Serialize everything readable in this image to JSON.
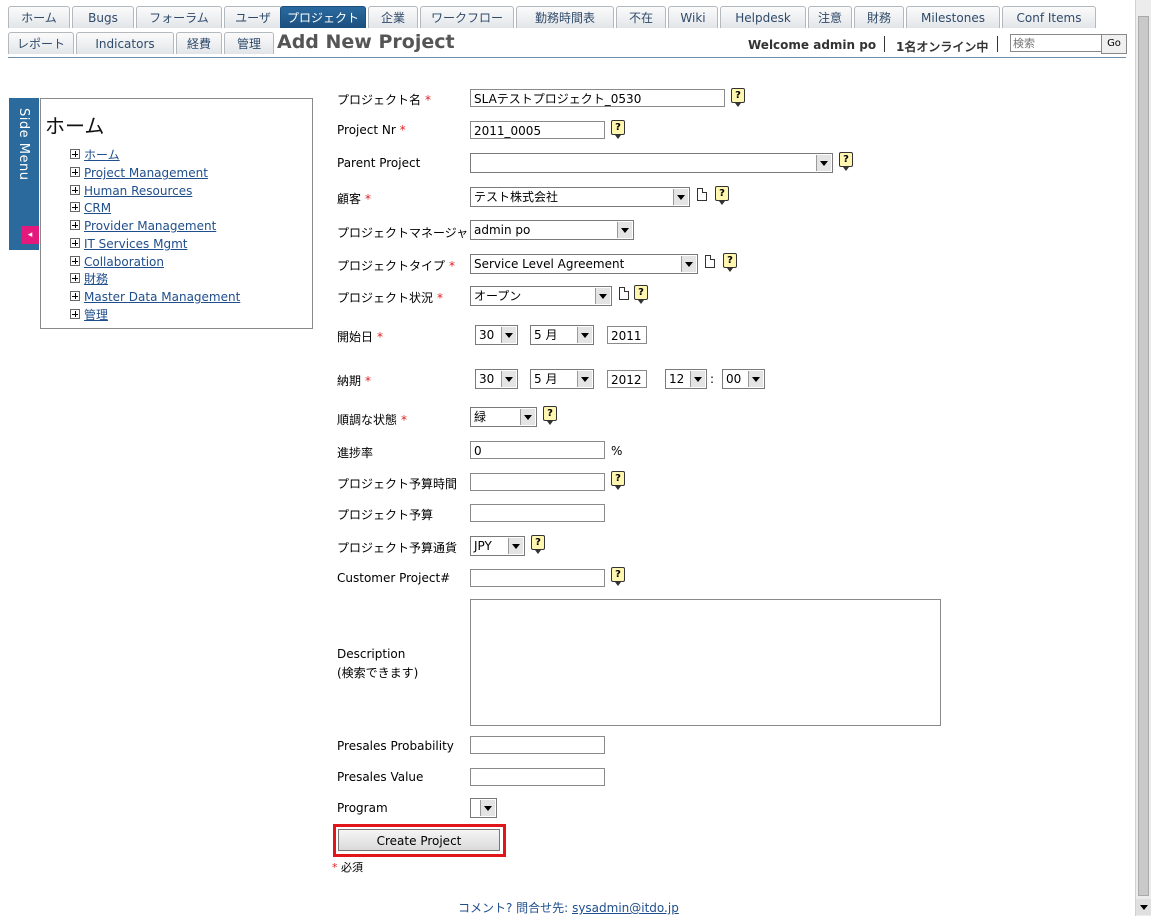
{
  "tabs_row1": [
    "ホーム",
    "Bugs",
    "フォーラム",
    "ユーザ",
    "プロジェクト",
    "企業",
    "ワークフロー",
    "勤務時間表",
    "不在",
    "Wiki",
    "Helpdesk",
    "注意",
    "財務",
    "Milestones",
    "Conf Items"
  ],
  "tabs_row2": [
    "レポート",
    "Indicators",
    "経費",
    "管理"
  ],
  "active_tab": "プロジェクト",
  "header": {
    "page_title": "Add New Project",
    "welcome": "Welcome admin po",
    "online": "1名オンライン中",
    "search_placeholder": "検索",
    "go_label": "Go"
  },
  "sidemenu": {
    "vertical_label": "Side Menu",
    "title": "ホーム",
    "items": [
      "ホーム",
      "Project Management",
      "Human Resources",
      "CRM",
      "Provider Management",
      "IT Services Mgmt",
      "Collaboration",
      "財務",
      "Master Data Management",
      "管理"
    ]
  },
  "form": {
    "project_name": {
      "label": "プロジェクト名",
      "value": "SLAテストプロジェクト_0530"
    },
    "project_nr": {
      "label": "Project Nr",
      "value": "2011_0005"
    },
    "parent_project": {
      "label": "Parent Project",
      "value": ""
    },
    "customer": {
      "label": "顧客",
      "value": "テスト株式会社"
    },
    "project_manager": {
      "label": "プロジェクトマネージャ",
      "value": "admin po"
    },
    "project_type": {
      "label": "プロジェクトタイプ",
      "value": "Service Level Agreement"
    },
    "project_status": {
      "label": "プロジェクト状況",
      "value": "オープン"
    },
    "start_date": {
      "label": "開始日",
      "day": "30",
      "month": "5 月",
      "year": "2011"
    },
    "end_date": {
      "label": "納期",
      "day": "30",
      "month": "5 月",
      "year": "2012",
      "hour": "12",
      "minute": "00",
      "sep": ":"
    },
    "on_track": {
      "label": "順調な状態",
      "value": "緑"
    },
    "percent_completed": {
      "label": "進捗率",
      "value": "0",
      "unit": "%"
    },
    "budget_hours": {
      "label": "プロジェクト予算時間",
      "value": ""
    },
    "budget": {
      "label": "プロジェクト予算",
      "value": ""
    },
    "budget_currency": {
      "label": "プロジェクト予算通貨",
      "value": "JPY"
    },
    "customer_project_nr": {
      "label": "Customer Project#",
      "value": ""
    },
    "description": {
      "label": "Description",
      "sublabel": "(検索できます)",
      "value": ""
    },
    "presales_probability": {
      "label": "Presales Probability",
      "value": ""
    },
    "presales_value": {
      "label": "Presales Value",
      "value": ""
    },
    "program": {
      "label": "Program",
      "value": ""
    },
    "required_marker": "*",
    "submit_label": "Create Project",
    "required_note": "必須"
  },
  "footer": {
    "text": "コメント? 問合せ先:",
    "email": "sysadmin@itdo.jp"
  },
  "colors": {
    "active_tab": "#1b4f7e",
    "required": "#e02020",
    "highlight": "#e0161b",
    "link": "#1f4e8c"
  }
}
